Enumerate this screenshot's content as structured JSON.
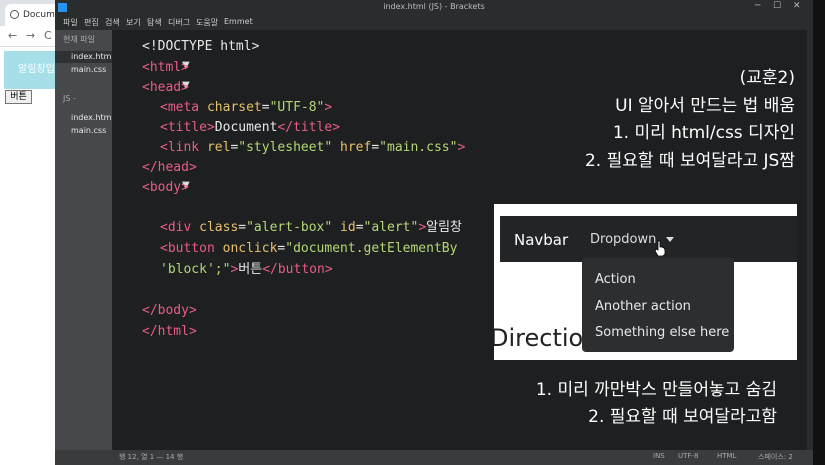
{
  "browser": {
    "tab_title": "Document",
    "nav_back": "←",
    "nav_forward": "→",
    "nav_reload": "C",
    "alert_text": "알림창입니다",
    "button_label": "버튼"
  },
  "brackets": {
    "window_title": "index.html (JS) - Brackets",
    "window_controls": [
      "─",
      "☐",
      "✕"
    ],
    "menu": [
      "파일",
      "편집",
      "검색",
      "보기",
      "탐색",
      "디버그",
      "도움말",
      "Emmet"
    ],
    "sidebar": {
      "working_files_header": "현재 파일",
      "working_files": [
        "index.html",
        "main.css"
      ],
      "project_header": "JS -",
      "project_files": [
        "index.html",
        "main.css"
      ]
    },
    "statusbar": {
      "position": "행 12, 열 1 — 14 행",
      "ins": "INS",
      "encoding": "UTF-8",
      "language": "HTML",
      "spaces": "스페이스: 2"
    }
  },
  "code": {
    "doctype": "<!DOCTYPE html>",
    "html_open": "<html>",
    "head_open": "<head>",
    "meta_tag": "<meta",
    "meta_attr": "charset",
    "meta_val": "\"UTF-8\"",
    "title_open": "<title>",
    "title_text": "Document",
    "title_close": "</title>",
    "link_tag": "<link",
    "link_rel": "rel",
    "link_rel_val": "\"stylesheet\"",
    "link_href": "href",
    "link_href_val": "\"main.css\"",
    "head_close": "</head>",
    "body_open": "<body>",
    "div_tag": "<div",
    "div_class": "class",
    "div_class_val": "\"alert-box\"",
    "div_id": "id",
    "div_id_val": "\"alert\"",
    "div_text": "알림창",
    "button_tag": "<button",
    "button_attr": "onclick",
    "button_val": "\"document.getElementBy",
    "button_cont": "'block';\"",
    "button_text": "버튼",
    "button_close": "</button>",
    "body_close": "</body>",
    "html_close": "</html>"
  },
  "notes": {
    "lesson_title": "(교훈2)",
    "lesson_line1": "UI 알아서 만드는 법 배움",
    "lesson_line2": "1. 미리 html/css 디자인",
    "lesson_line3": "2. 필요할 때 보여달라고 JS짬",
    "bottom_line1": "1. 미리 까만박스 만들어놓고 숨김",
    "bottom_line2": "2. 필요할 때 보여달라고함"
  },
  "navbar_example": {
    "brand": "Navbar",
    "dropdown": "Dropdown",
    "items": [
      "Action",
      "Another action",
      "Something else here"
    ],
    "behind_text": "Direction"
  },
  "colors": {
    "tag": "#e85d86",
    "attribute": "#e6c06a",
    "string": "#b4d774",
    "alert_bg": "#a6dfe8"
  }
}
